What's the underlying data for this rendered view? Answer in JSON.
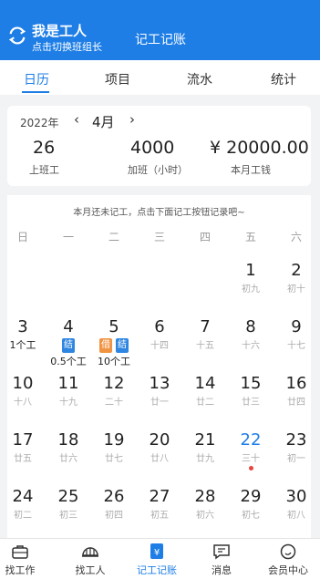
{
  "header": {
    "role_title": "我是工人",
    "role_subtitle": "点击切换班组长",
    "app_title": "记工记账"
  },
  "tabs": [
    {
      "label": "日历",
      "active": true
    },
    {
      "label": "项目",
      "active": false
    },
    {
      "label": "流水",
      "active": false
    },
    {
      "label": "统计",
      "active": false
    }
  ],
  "summary": {
    "year": "2022年",
    "prev": "‹",
    "month": "4月",
    "next": "›",
    "stats": [
      {
        "value": "26",
        "label": "上班工"
      },
      {
        "value": "4000",
        "label": "加班（小时）"
      },
      {
        "value": "¥ 20000.00",
        "label": "本月工钱"
      }
    ]
  },
  "calendar": {
    "notice": "本月还未记工，点击下面记工按钮记录吧~",
    "weekdays": [
      "日",
      "一",
      "二",
      "三",
      "四",
      "五",
      "六"
    ],
    "today_color": "#1e7ee6",
    "days": [
      {
        "day": "1",
        "lunar": "初九"
      },
      {
        "day": "2",
        "lunar": "初十"
      },
      {
        "day": "3",
        "work": "1个工"
      },
      {
        "day": "4",
        "badges": [
          {
            "text": "结",
            "color": "blue"
          }
        ],
        "work": "0.5个工"
      },
      {
        "day": "5",
        "badges": [
          {
            "text": "借",
            "color": "orange"
          },
          {
            "text": "结",
            "color": "blue"
          }
        ],
        "work": "10个工"
      },
      {
        "day": "6",
        "lunar": "十四"
      },
      {
        "day": "7",
        "lunar": "十五"
      },
      {
        "day": "8",
        "lunar": "十六"
      },
      {
        "day": "9",
        "lunar": "十七"
      },
      {
        "day": "10",
        "lunar": "十八"
      },
      {
        "day": "11",
        "lunar": "十九"
      },
      {
        "day": "12",
        "lunar": "二十"
      },
      {
        "day": "13",
        "lunar": "廿一"
      },
      {
        "day": "14",
        "lunar": "廿二"
      },
      {
        "day": "15",
        "lunar": "廿三"
      },
      {
        "day": "16",
        "lunar": "廿四"
      },
      {
        "day": "17",
        "lunar": "廿五"
      },
      {
        "day": "18",
        "lunar": "廿六"
      },
      {
        "day": "19",
        "lunar": "廿七"
      },
      {
        "day": "20",
        "lunar": "廿八"
      },
      {
        "day": "21",
        "lunar": "廿九"
      },
      {
        "day": "22",
        "lunar": "三十",
        "today": true
      },
      {
        "day": "23",
        "lunar": "初一"
      },
      {
        "day": "24",
        "lunar": "初二"
      },
      {
        "day": "25",
        "lunar": "初三"
      },
      {
        "day": "26",
        "lunar": "初四"
      },
      {
        "day": "27",
        "lunar": "初五"
      },
      {
        "day": "28",
        "lunar": "初六"
      },
      {
        "day": "29",
        "lunar": "初七"
      },
      {
        "day": "30",
        "lunar": "初八"
      }
    ]
  },
  "bottom_nav": [
    {
      "label": "找工作",
      "icon": "briefcase-icon"
    },
    {
      "label": "找工人",
      "icon": "helmet-icon"
    },
    {
      "label": "记工记账",
      "icon": "ledger-icon",
      "active": true
    },
    {
      "label": "消息",
      "icon": "message-icon"
    },
    {
      "label": "会员中心",
      "icon": "member-icon"
    }
  ]
}
